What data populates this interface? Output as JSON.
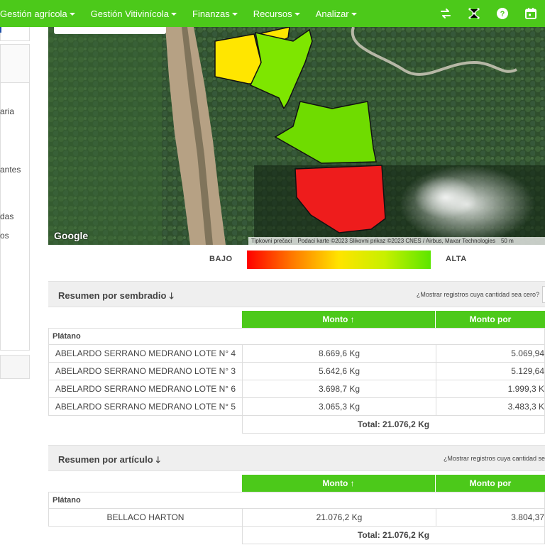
{
  "nav": {
    "items": [
      {
        "label": "Gestión agrícola"
      },
      {
        "label": "Gestión Vitivinícola"
      },
      {
        "label": "Finanzas"
      },
      {
        "label": "Recursos"
      },
      {
        "label": "Analizar"
      }
    ],
    "icons": [
      "swap-icon",
      "network-icon",
      "help-icon",
      "calendar-icon"
    ]
  },
  "sidebar": {
    "fragments": [
      "aria",
      "antes",
      "das",
      "os"
    ]
  },
  "map": {
    "attribution": [
      "Tipkovni prečaci",
      "Podaci karte ©2023 Slikovni prikaz ©2023 CNES / Airbus, Maxar Technologies",
      "50 m"
    ],
    "logo": "Google"
  },
  "legend": {
    "low": "BAJO",
    "high": "ALTA",
    "colors": [
      "#ff0000",
      "#ff7a00",
      "#ffe400",
      "#c8f000",
      "#5ce600"
    ]
  },
  "sembradio": {
    "title": "Resumen por sembradio",
    "question": "¿Mostrar registros cuya cantidad sea cero?",
    "col_monto": "Monto ↑",
    "col_monto_por": "Monto por",
    "group": "Plátano",
    "rows": [
      {
        "name": "ABELARDO SERRANO MEDRANO LOTE N° 4",
        "monto": "8.669,6 Kg",
        "monto_por": "5.069,94"
      },
      {
        "name": "ABELARDO SERRANO MEDRANO LOTE N° 3",
        "monto": "5.642,6 Kg",
        "monto_por": "5.129,64"
      },
      {
        "name": "ABELARDO SERRANO MEDRANO LOTE N° 6",
        "monto": "3.698,7 Kg",
        "monto_por": "1.999,3 K"
      },
      {
        "name": "ABELARDO SERRANO MEDRANO LOTE N° 5",
        "monto": "3.065,3 Kg",
        "monto_por": "3.483,3 K"
      }
    ],
    "total": "Total: 21.076,2  Kg"
  },
  "articulo": {
    "title": "Resumen por artículo",
    "question": "¿Mostrar registros cuya cantidad se",
    "col_monto": "Monto ↑",
    "col_monto_por": "Monto por",
    "group": "Plátano",
    "rows": [
      {
        "name": "BELLACO HARTON",
        "monto": "21.076,2 Kg",
        "monto_por": "3.804,37"
      }
    ],
    "total": "Total: 21.076,2  Kg"
  },
  "polygons": [
    {
      "name": "lote-4",
      "color": "#ffe600"
    },
    {
      "name": "lote-3",
      "color": "#7ee600"
    },
    {
      "name": "lote-6",
      "color": "#6fdc00"
    },
    {
      "name": "lote-5",
      "color": "#ee1c1c"
    }
  ]
}
